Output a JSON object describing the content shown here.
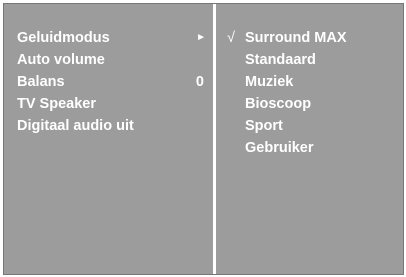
{
  "left_menu": {
    "items": [
      {
        "label": "Geluidmodus",
        "has_submenu": true,
        "icon": "arrow-right-icon"
      },
      {
        "label": "Auto volume"
      },
      {
        "label": "Balans",
        "value": "0"
      },
      {
        "label": "TV Speaker"
      },
      {
        "label": "Digitaal audio uit"
      }
    ]
  },
  "right_menu": {
    "selected": "Surround MAX",
    "check_glyph": "√",
    "options": [
      {
        "label": "Surround MAX",
        "checked": true
      },
      {
        "label": "Standaard"
      },
      {
        "label": "Muziek"
      },
      {
        "label": "Bioscoop"
      },
      {
        "label": "Sport"
      },
      {
        "label": "Gebruiker"
      }
    ]
  },
  "colors": {
    "panel_bg": "#9c9c9c",
    "text": "#ffffff",
    "divider": "#ffffff"
  }
}
